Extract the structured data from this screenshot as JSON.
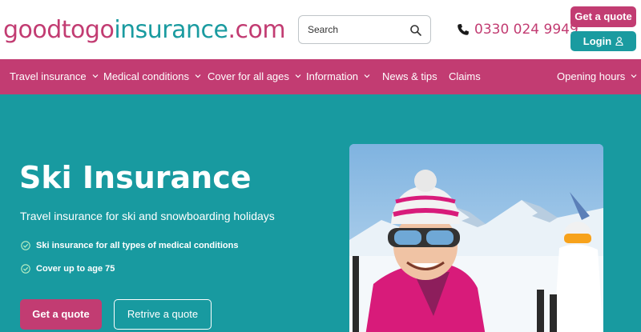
{
  "header": {
    "logo_part1": "goodtogo",
    "logo_part2": "insurance",
    "logo_part3": ".com",
    "search_placeholder": "Search",
    "phone": "0330 024 9949",
    "get_quote": "Get a quote",
    "login": "Login"
  },
  "nav": {
    "items": [
      {
        "label": "Travel insurance"
      },
      {
        "label": "Medical conditions"
      },
      {
        "label": "Cover for all ages"
      },
      {
        "label": "Information"
      },
      {
        "label": "News & tips"
      },
      {
        "label": "Claims"
      },
      {
        "label": "Opening hours"
      }
    ]
  },
  "hero": {
    "title": "Ski Insurance",
    "subtitle": "Travel insurance for ski and snowboarding holidays",
    "bullets": [
      "Ski insurance for all types of medical conditions",
      "Cover up to age 75"
    ],
    "get_quote": "Get a quote",
    "retrieve": "Retrive a quote"
  },
  "colors": {
    "brand_pink": "#c23c72",
    "brand_teal": "#1a9ba0"
  },
  "icons": [
    "search-icon",
    "phone-icon",
    "user-icon",
    "chevron-down-icon",
    "check-circle-icon"
  ]
}
